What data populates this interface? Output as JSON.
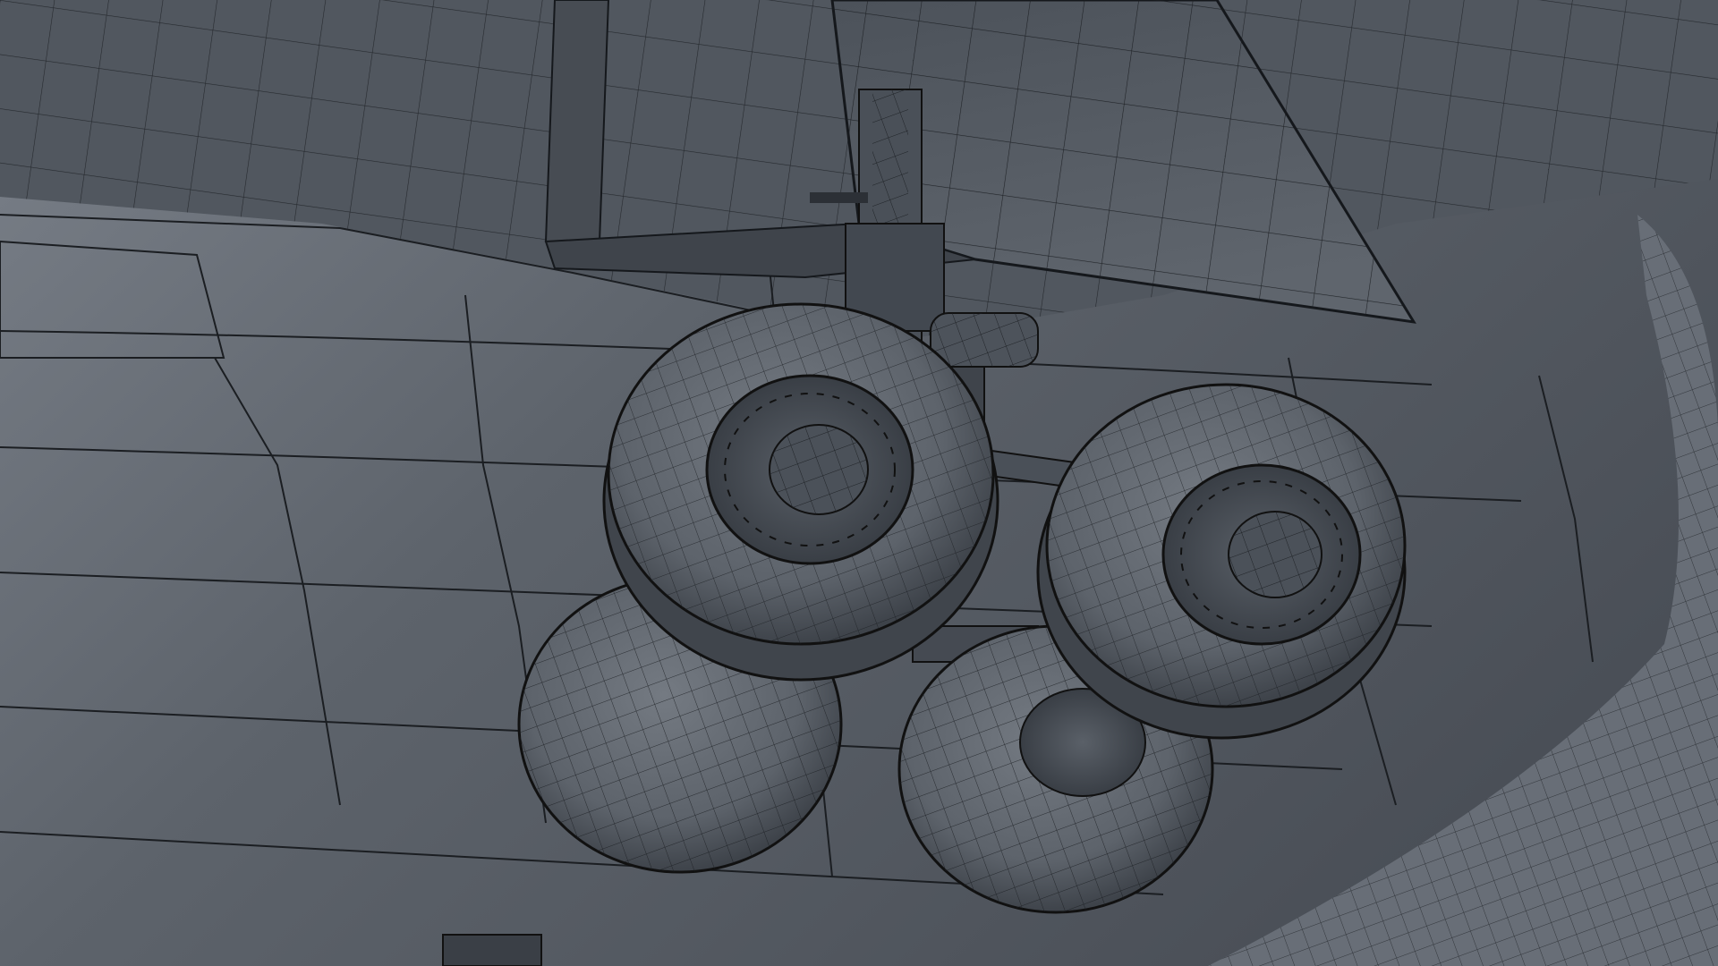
{
  "viewport": {
    "content": "wireframe-render",
    "subject": "landing-gear-bogie",
    "wheel_count": 4
  },
  "colors": {
    "background": "#2e3238",
    "surface_light": "#6d737c",
    "surface_mid": "#555b63",
    "surface_dark": "#3f444b",
    "wire": "#16191d",
    "tire": "#5e646c",
    "tire_shadow": "#3a3f46",
    "hub": "#4a5058"
  }
}
